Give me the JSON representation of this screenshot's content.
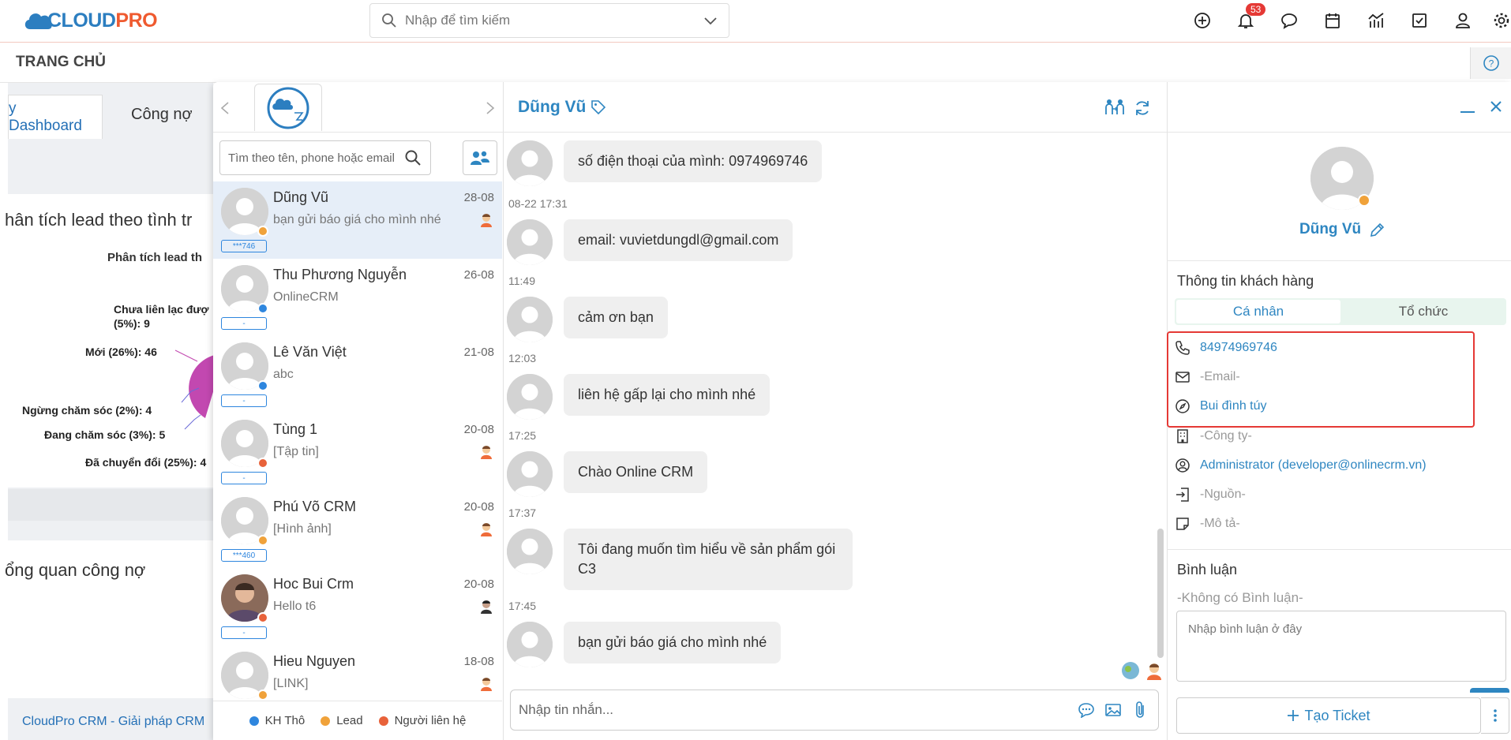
{
  "app": {
    "logo_text_main": "CLOUD",
    "logo_text_accent": "PRO",
    "search_placeholder": "Nhập để tìm kiếm",
    "notification_count": "53",
    "page_title": "TRANG CHỦ",
    "colors": {
      "brand_blue": "#2e86c1",
      "brand_orange": "#ef5a2f",
      "alert_red": "#e53935"
    }
  },
  "dashboard": {
    "tabs": [
      "y Dashboard",
      "Công nợ"
    ],
    "section1_title": "hân tích lead theo tình tr",
    "chart_subtitle": "Phân tích lead th",
    "pie_labels": [
      "Chưa liên lạc đượ",
      "(5%): 9",
      "Mới (26%): 46",
      "Ngừng chăm sóc (2%): 4",
      "Đang chăm sóc (3%): 5",
      "Đã chuyển đổi (25%): 4"
    ],
    "section2_title": "ổng quan công nợ",
    "footer": "CloudPro CRM - Giải pháp CRM"
  },
  "contacts": {
    "search_placeholder": "Tìm theo tên, phone hoặc email",
    "items": [
      {
        "name": "Dũng Vũ",
        "date": "28-08",
        "message": "bạn gửi báo giá cho mình nhé",
        "tag": "***746",
        "status_color": "#f0a23a"
      },
      {
        "name": "Thu Phương Nguyễn",
        "date": "26-08",
        "message": "OnlineCRM",
        "tag": "-",
        "status_color": "#2e86de"
      },
      {
        "name": "Lê Văn Việt",
        "date": "21-08",
        "message": "abc",
        "tag": "-",
        "status_color": "#2e86de"
      },
      {
        "name": "Tùng 1",
        "date": "20-08",
        "message": "[Tập tin]",
        "tag": "-",
        "status_color": "#e8623a"
      },
      {
        "name": "Phú Võ CRM",
        "date": "20-08",
        "message": "[Hình ảnh]",
        "tag": "***460",
        "status_color": "#f0a23a"
      },
      {
        "name": "Hoc Bui Crm",
        "date": "20-08",
        "message": "Hello t6",
        "tag": "-",
        "status_color": "#e8623a"
      },
      {
        "name": "Hieu Nguyen",
        "date": "18-08",
        "message": "[LINK]",
        "tag": "",
        "status_color": "#f0a23a"
      }
    ],
    "legend": [
      {
        "label": "KH Thô",
        "color": "#2e86de"
      },
      {
        "label": "Lead",
        "color": "#f0a23a"
      },
      {
        "label": "Người liên hệ",
        "color": "#e8623a"
      }
    ]
  },
  "conversation": {
    "contact_name": "Dũng Vũ",
    "messages": [
      {
        "time": "",
        "text": "số điện thoại của mình: 0974969746"
      },
      {
        "time": "08-22 17:31",
        "text": "email: vuvietdungdl@gmail.com"
      },
      {
        "time": "11:49",
        "text": "cảm ơn bạn"
      },
      {
        "time": "12:03",
        "text": "liên hệ gấp lại cho mình nhé"
      },
      {
        "time": "17:25",
        "text": "Chào Online CRM"
      },
      {
        "time": "17:37",
        "text": "Tôi đang muốn tìm hiểu về sản phẩm gói C3"
      },
      {
        "time": "17:45",
        "text": "bạn gửi báo giá cho mình nhé"
      }
    ],
    "composer_placeholder": "Nhập tin nhắn..."
  },
  "detail": {
    "name": "Dũng Vũ",
    "info_title": "Thông tin khách hàng",
    "tab_personal": "Cá nhân",
    "tab_org": "Tổ chức",
    "phone": "84974969746",
    "email": "-Email-",
    "address": "Bui đình túy",
    "company": "-Công ty-",
    "owner": "Administrator (developer@onlinecrm.vn)",
    "source": "-Nguồn-",
    "description": "-Mô tả-",
    "comments_title": "Bình luận",
    "no_comments": "-Không có Bình luận-",
    "comment_placeholder": "Nhập bình luận ở đây",
    "ticket_button": "Tạo Ticket"
  }
}
